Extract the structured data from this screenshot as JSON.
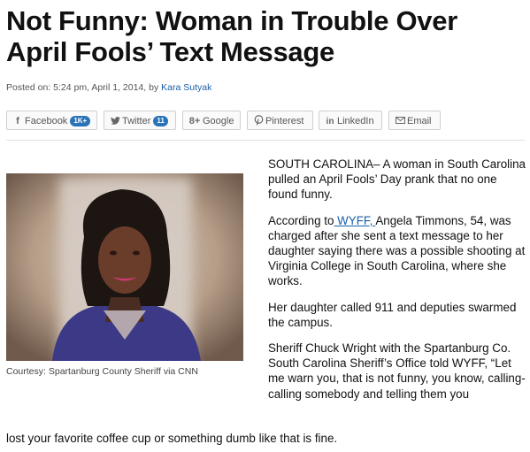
{
  "article": {
    "headline": "Not Funny: Woman in Trouble Over April Fools’ Text Message",
    "byline_prefix": "Posted on: 5:24 pm, April 1, 2014, by ",
    "author": "Kara Sutyak"
  },
  "share": {
    "facebook_label": "Facebook",
    "facebook_count": "1K+",
    "twitter_label": "Twitter",
    "twitter_count": "11",
    "google_label": "Google",
    "pinterest_label": "Pinterest",
    "linkedin_label": "LinkedIn",
    "email_label": "Email"
  },
  "photo": {
    "caption": "Courtesy: Spartanburg County Sheriff via CNN"
  },
  "body": {
    "p1": "SOUTH CAROLINA– A woman in South Carolina pulled an April Fools’ Day prank that no one found funny.",
    "p2_before": "According to",
    "p2_link": " WYFF, ",
    "p2_after": "Angela Timmons, 54, was charged after she sent a text message to her daughter saying there was a possible shooting at Virginia College in South Carolina, where she works.",
    "p3": "Her daughter called 911 and deputies swarmed the campus.",
    "p4": "Sheriff Chuck Wright with the Spartanburg Co. South Carolina Sheriff’s Office told WYFF, “Let me warn you, that is not funny, you know, calling-calling somebody and telling them you",
    "p4_last_line": "lost your favorite coffee cup or something dumb like that is fine."
  },
  "icons": {
    "facebook": "facebook-icon",
    "twitter": "twitter-icon",
    "google": "google-plus-icon",
    "pinterest": "pinterest-icon",
    "linkedin": "linkedin-icon",
    "email": "email-icon"
  },
  "colors": {
    "link": "#1a5fa8",
    "badge": "#2b73b8"
  }
}
